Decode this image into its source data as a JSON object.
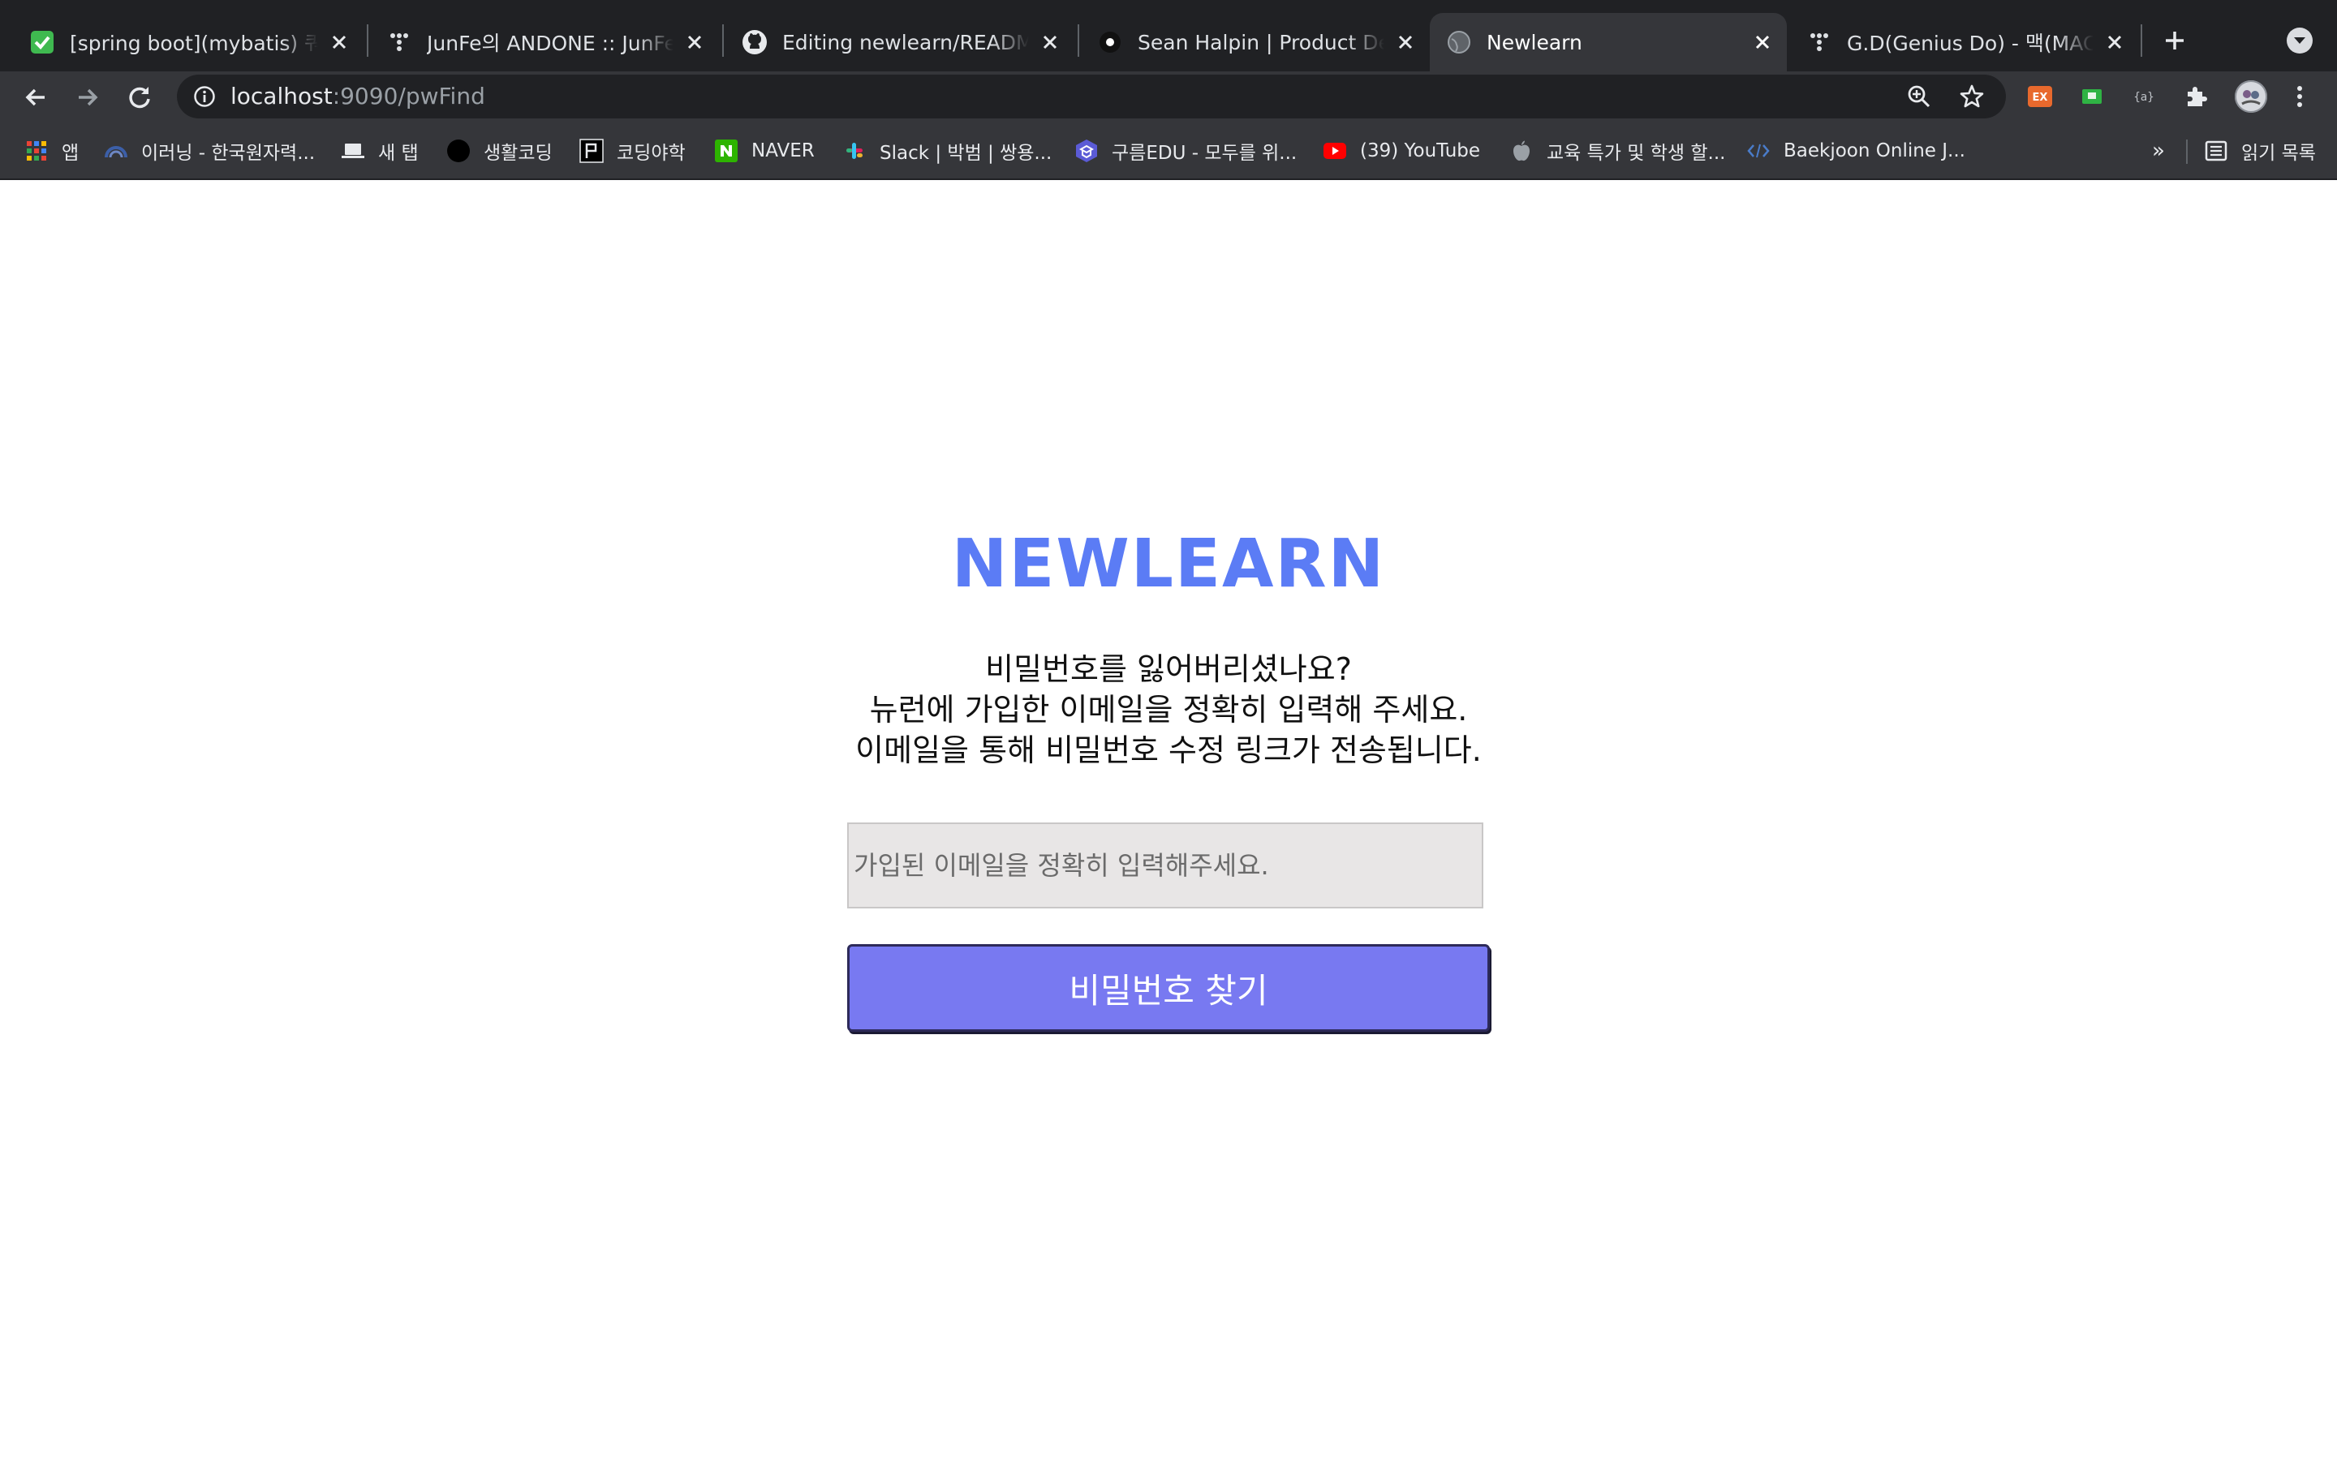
{
  "browser": {
    "tabs": [
      {
        "title": "[spring boot](mybatis) 쿼리",
        "favicon": "green-check-icon",
        "active": false
      },
      {
        "title": "JunFe의 ANDONE :: JunFe의",
        "favicon": "tistory-icon",
        "active": false
      },
      {
        "title": "Editing newlearn/README.m",
        "favicon": "github-icon",
        "active": false
      },
      {
        "title": "Sean Halpin | Product Desig",
        "favicon": "dot-icon",
        "active": false
      },
      {
        "title": "Newlearn",
        "favicon": "globe-icon",
        "active": true
      },
      {
        "title": "G.D(Genius Do) - 맥(MAC) 터",
        "favicon": "tistory-icon",
        "active": false
      }
    ],
    "address": {
      "host": "localhost",
      "path": ":9090/pwFind"
    },
    "extensions": [
      "ex-extension-icon",
      "green-extension-icon",
      "json-extension-icon",
      "puzzle-icon",
      "profile-avatar"
    ],
    "bookmarks": [
      {
        "label": "앱",
        "icon": "apps-grid-icon"
      },
      {
        "label": "이러닝 - 한국원자력...",
        "icon": "rainbow-icon"
      },
      {
        "label": "새 탭",
        "icon": "laptop-icon"
      },
      {
        "label": "생활코딩",
        "icon": "black-circle-icon"
      },
      {
        "label": "코딩야학",
        "icon": "opentutorials-icon"
      },
      {
        "label": "NAVER",
        "icon": "naver-icon"
      },
      {
        "label": "Slack | 박범 | 쌍용...",
        "icon": "slack-icon"
      },
      {
        "label": "구름EDU - 모두를 위...",
        "icon": "goorm-icon"
      },
      {
        "label": "(39) YouTube",
        "icon": "youtube-icon"
      },
      {
        "label": "교육 특가 및 학생 할...",
        "icon": "apple-icon"
      },
      {
        "label": "Baekjoon Online J...",
        "icon": "code-icon"
      }
    ],
    "more_bookmarks": "»",
    "reading_list": "읽기 목록"
  },
  "page": {
    "logo": "NEWLEARN",
    "description_lines": [
      "비밀번호를 잃어버리셨나요?",
      "뉴런에 가입한 이메일을 정확히 입력해 주세요.",
      "이메일을 통해 비밀번호 수정 링크가 전송됩니다."
    ],
    "email_input": {
      "value": "",
      "placeholder": "가입된 이메일을 정확히 입력해주세요."
    },
    "submit_label": "비밀번호 찾기"
  },
  "colors": {
    "logo": "#5b7cf5",
    "button": "#7879f1",
    "tabstrip": "#202124",
    "toolbar": "#35363a"
  }
}
